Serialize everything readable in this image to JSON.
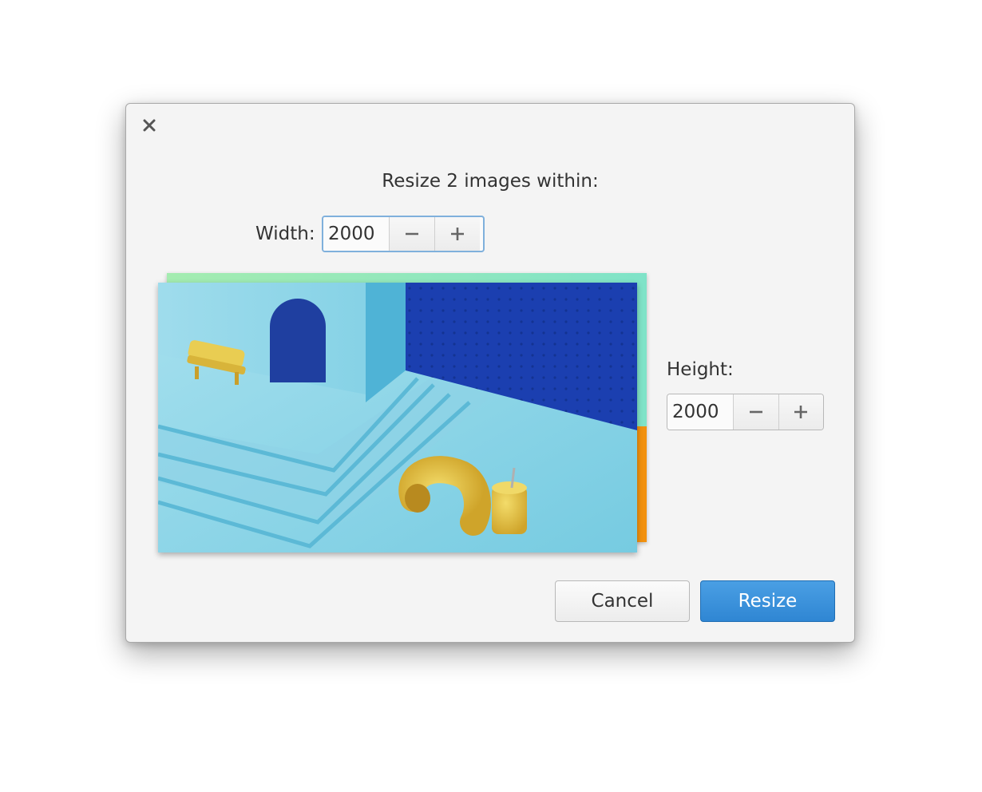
{
  "dialog": {
    "title": "Resize 2 images within:",
    "width_label": "Width:",
    "width_value": "2000",
    "height_label": "Height:",
    "height_value": "2000",
    "cancel_label": "Cancel",
    "resize_label": "Resize"
  },
  "icons": {
    "close": "close-icon",
    "decrement": "minus-icon",
    "increment": "plus-icon"
  },
  "colors": {
    "accent": "#3a90db",
    "dialog_bg": "#f4f4f4",
    "focus_border": "#7fb0dc"
  }
}
